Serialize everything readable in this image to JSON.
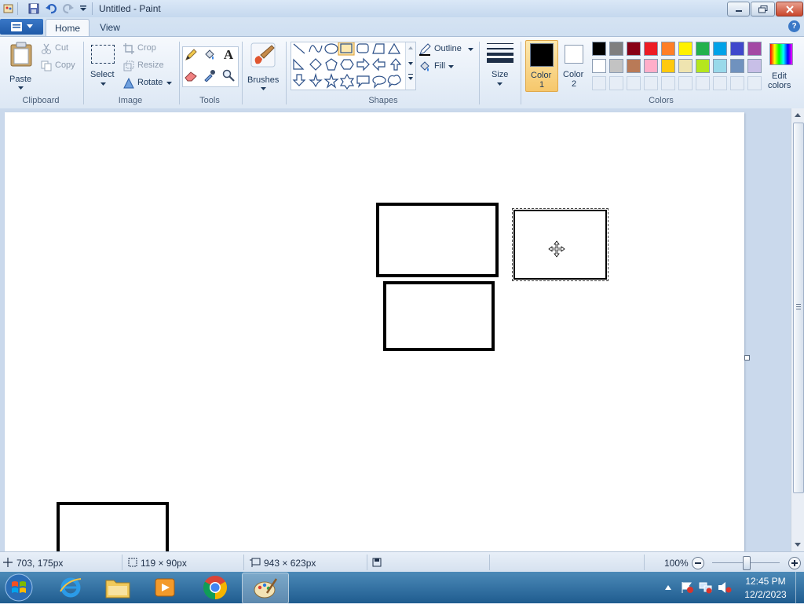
{
  "window": {
    "title": "Untitled - Paint"
  },
  "tabs": {
    "home": "Home",
    "view": "View"
  },
  "clipboard": {
    "paste": "Paste",
    "cut": "Cut",
    "copy": "Copy",
    "label": "Clipboard"
  },
  "image": {
    "select": "Select",
    "crop": "Crop",
    "resize": "Resize",
    "rotate": "Rotate",
    "label": "Image"
  },
  "tools": {
    "label": "Tools",
    "text_glyph": "A"
  },
  "brushes": {
    "label": "Brushes"
  },
  "shapes": {
    "outline": "Outline",
    "fill": "Fill",
    "label": "Shapes",
    "selected": "rectangle"
  },
  "size": {
    "label": "Size"
  },
  "colors": {
    "color1_label_a": "Color",
    "color1_label_b": "1",
    "color2_label_a": "Color",
    "color2_label_b": "2",
    "edit_a": "Edit",
    "edit_b": "colors",
    "label": "Colors",
    "color1": "#000000",
    "color2": "#ffffff",
    "row1": [
      "#000000",
      "#7f7f7f",
      "#880015",
      "#ed1c24",
      "#ff7f27",
      "#fff200",
      "#22b14c",
      "#00a2e8",
      "#3f48cc",
      "#a349a4"
    ],
    "row2": [
      "#ffffff",
      "#c3c3c3",
      "#b97a57",
      "#ffaec9",
      "#ffc90e",
      "#efe4b0",
      "#b5e61d",
      "#99d9ea",
      "#7092be",
      "#c8bfe7"
    ]
  },
  "status": {
    "cursor_pos": "703, 175px",
    "selection_size": "119 × 90px",
    "image_size": "943 × 623px",
    "zoom": "100%"
  },
  "taskbar": {
    "time": "12:45 PM",
    "date": "12/2/2023"
  }
}
